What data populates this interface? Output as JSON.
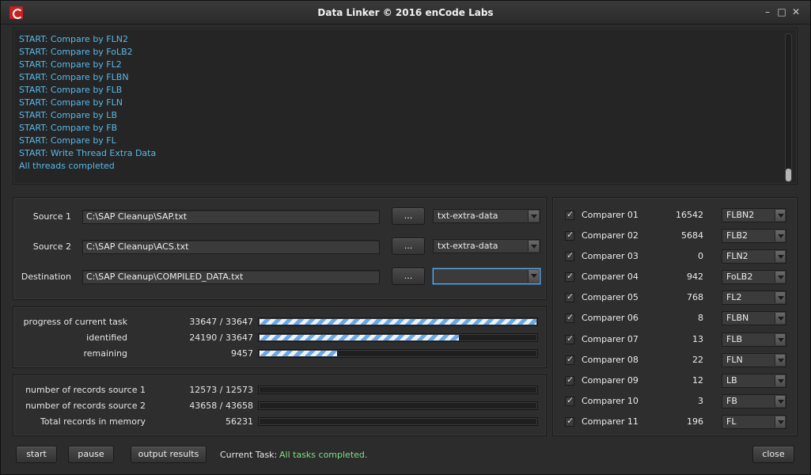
{
  "window": {
    "title": "Data Linker © 2016 enCode Labs",
    "minimize_icon": "minimize-icon",
    "maximize_icon": "maximize-icon",
    "close_icon": "close-icon"
  },
  "log": {
    "lines": [
      "START: Compare by FLN2",
      "START: Compare by FoLB2",
      "START: Compare by FL2",
      "START: Compare by FLBN",
      "START: Compare by FLB",
      "START: Compare by FLN",
      "START: Compare by LB",
      "START: Compare by FB",
      "START: Compare by FL",
      "START: Write Thread Extra Data",
      "All threads completed"
    ]
  },
  "sources": {
    "source1": {
      "label": "Source 1",
      "path": "C:\\SAP Cleanup\\SAP.txt",
      "browse": "...",
      "format": "txt-extra-data"
    },
    "source2": {
      "label": "Source 2",
      "path": "C:\\SAP Cleanup\\ACS.txt",
      "browse": "...",
      "format": "txt-extra-data"
    },
    "destination": {
      "label": "Destination",
      "path": "C:\\SAP Cleanup\\COMPILED_DATA.txt",
      "browse": "...",
      "format": ""
    }
  },
  "progress": {
    "current_task": {
      "label": "progress of current task",
      "value": "33647 / 33647",
      "fraction": 1.0
    },
    "identified": {
      "label": "identified",
      "value": "24190 / 33647",
      "fraction": 0.719
    },
    "remaining": {
      "label": "remaining",
      "value": "9457",
      "fraction": 0.281
    }
  },
  "records": {
    "source1": {
      "label": "number of records source 1",
      "value": "12573 / 12573",
      "fraction": 0
    },
    "source2": {
      "label": "number of records source 2",
      "value": "43658 / 43658",
      "fraction": 0
    },
    "total": {
      "label": "Total records in memory",
      "value": "56231",
      "fraction": 0
    }
  },
  "comparers": [
    {
      "name": "Comparer 01",
      "count": "16542",
      "method": "FLBN2"
    },
    {
      "name": "Comparer 02",
      "count": "5684",
      "method": "FLB2"
    },
    {
      "name": "Comparer 03",
      "count": "0",
      "method": "FLN2"
    },
    {
      "name": "Comparer 04",
      "count": "942",
      "method": "FoLB2"
    },
    {
      "name": "Comparer 05",
      "count": "768",
      "method": "FL2"
    },
    {
      "name": "Comparer 06",
      "count": "8",
      "method": "FLBN"
    },
    {
      "name": "Comparer 07",
      "count": "13",
      "method": "FLB"
    },
    {
      "name": "Comparer 08",
      "count": "22",
      "method": "FLN"
    },
    {
      "name": "Comparer 09",
      "count": "12",
      "method": "LB"
    },
    {
      "name": "Comparer 10",
      "count": "3",
      "method": "FB"
    },
    {
      "name": "Comparer 11",
      "count": "196",
      "method": "FL"
    }
  ],
  "footer": {
    "start": "start",
    "pause": "pause",
    "output": "output results",
    "current_task_label": "Current Task:",
    "current_task_value": "All tasks completed.",
    "close": "close"
  },
  "colors": {
    "log_text": "#58b8ea",
    "status_ok": "#7fe07f",
    "bar_fill": "#6aa9e6"
  }
}
